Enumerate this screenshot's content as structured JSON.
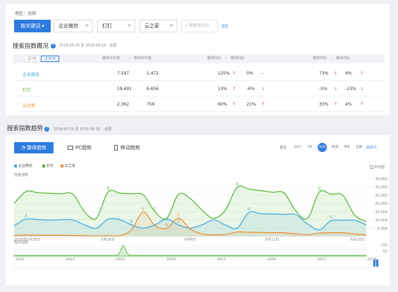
{
  "filter": {
    "region_label": "地区：全国",
    "search_type_label": "按关键词",
    "keywords": [
      "企业微信",
      "钉钉",
      "云之家"
    ],
    "add_compare_label": "+ 添加对比词",
    "clear_label": "清空"
  },
  "overview": {
    "title": "搜索指数概况",
    "date_range": "2018-05-20 至 2018-06-18",
    "scope": "全国",
    "periods": [
      "近7天",
      "近30天"
    ],
    "active_period": "近30天",
    "headers": {
      "overall_avg": "整体日均值",
      "mobile_avg": "移动日均值",
      "overall_yoy": "整体同比",
      "mobile_yoy": "移动同比",
      "overall_qoq": "整体环比",
      "mobile_qoq": "移动环比"
    },
    "rows": [
      {
        "keyword": "企业微信",
        "color": "#3aa7e2",
        "overall_avg": "7,597",
        "mobile_avg": "1,472",
        "overall_yoy": "125%",
        "overall_yoy_dir": "up",
        "mobile_yoy": "0%",
        "mobile_yoy_dir": "flat",
        "overall_qoq": "73%",
        "overall_qoq_dir": "up",
        "mobile_qoq": "4%",
        "mobile_qoq_dir": "up"
      },
      {
        "keyword": "钉钉",
        "color": "#50b432",
        "overall_avg": "19,691",
        "mobile_avg": "6,656",
        "overall_yoy": "13%",
        "overall_yoy_dir": "up",
        "mobile_yoy": "-6%",
        "mobile_yoy_dir": "down",
        "overall_qoq": "-5%",
        "overall_qoq_dir": "down",
        "mobile_qoq": "-13%",
        "mobile_qoq_dir": "down"
      },
      {
        "keyword": "云之家",
        "color": "#f08a24",
        "overall_avg": "2,362",
        "mobile_avg": "759",
        "overall_yoy": "60%",
        "overall_yoy_dir": "up",
        "mobile_yoy": "21%",
        "mobile_yoy_dir": "up",
        "overall_qoq": "33%",
        "overall_qoq_dir": "up",
        "mobile_qoq": "4%",
        "mobile_qoq_dir": "up"
      }
    ]
  },
  "trend": {
    "title": "搜索指数趋势",
    "date_range": "2018-05-20 至 2018-06-18",
    "scope": "全国",
    "tabs": [
      "整体趋势",
      "PC趋势",
      "移动趋势"
    ],
    "active_tab": "整体趋势",
    "ranges": [
      "最近",
      "24小",
      "7天",
      "30天",
      "90天",
      "半年",
      "全部",
      "自定义"
    ],
    "active_range": "30天",
    "avg_label": "平均值"
  },
  "chart_data": {
    "type": "line",
    "ylabel": "搜索指数",
    "ylim": [
      0,
      35000
    ],
    "y_ticks": [
      "35,000",
      "30,000",
      "25,000",
      "20,000",
      "15,000",
      "10,000",
      "5,000"
    ],
    "x_tick_labels": [
      "2018年5月20日",
      "5月28日",
      "6月4日",
      "6月11日",
      "6月18日"
    ],
    "series": [
      {
        "name": "企业微信",
        "color": "#3aa7e2",
        "values": [
          6500,
          10500,
          10200,
          9900,
          10100,
          10000,
          7000,
          5000,
          10500,
          10200,
          7000,
          5000,
          7000,
          10500,
          7000,
          5000,
          7000,
          10000,
          7000,
          5000,
          14500,
          13800,
          13600,
          13400,
          13200,
          7500,
          4000,
          9500,
          9700,
          9800,
          7000
        ]
      },
      {
        "name": "钉钉",
        "color": "#50b432",
        "values": [
          20000,
          27200,
          26600,
          26200,
          25900,
          25700,
          15000,
          11000,
          27000,
          26300,
          25900,
          25200,
          15000,
          11000,
          25500,
          23000,
          16000,
          11000,
          16000,
          29800,
          28700,
          27800,
          26800,
          26300,
          15500,
          11000,
          27000,
          25600,
          25000,
          13000,
          9000
        ]
      },
      {
        "name": "云之家",
        "color": "#f08a24",
        "values": [
          600,
          800,
          700,
          700,
          700,
          600,
          500,
          400,
          500,
          500,
          4000,
          14800,
          6500,
          5000,
          11000,
          4500,
          1500,
          1000,
          1200,
          2700,
          2500,
          2400,
          2300,
          2200,
          1500,
          1000,
          2000,
          2300,
          2200,
          1500,
          900
        ]
      }
    ],
    "point_labels": [
      {
        "text": "A",
        "series": "企业微信",
        "index": 1
      },
      {
        "text": "B",
        "series": "钉钉",
        "index": 8
      },
      {
        "text": "C",
        "series": "钉钉",
        "index": 12
      },
      {
        "text": "D",
        "series": "钉钉",
        "index": 19
      },
      {
        "text": "E",
        "series": "钉钉",
        "index": 26
      },
      {
        "text": "A",
        "series": "云之家",
        "index": 11
      },
      {
        "text": "B",
        "series": "企业微信",
        "index": 10
      },
      {
        "text": "C",
        "series": "企业微信",
        "index": 14
      },
      {
        "text": "B",
        "series": "云之家",
        "index": 13
      },
      {
        "text": "C",
        "series": "云之家",
        "index": 14
      },
      {
        "text": "D",
        "series": "企业微信",
        "index": 20
      },
      {
        "text": "E",
        "series": "企业微信",
        "index": 27
      }
    ],
    "overview_label": "媒体指数",
    "overview_y_ticks": [
      "100",
      "50"
    ],
    "year_ticks": [
      "2011",
      "2012",
      "2013",
      "2014",
      "2015",
      "2016",
      "2017",
      "2018"
    ]
  },
  "colors": {
    "accent": "#2d7be0",
    "up": "#e9402f",
    "down": "#3bb23a"
  }
}
